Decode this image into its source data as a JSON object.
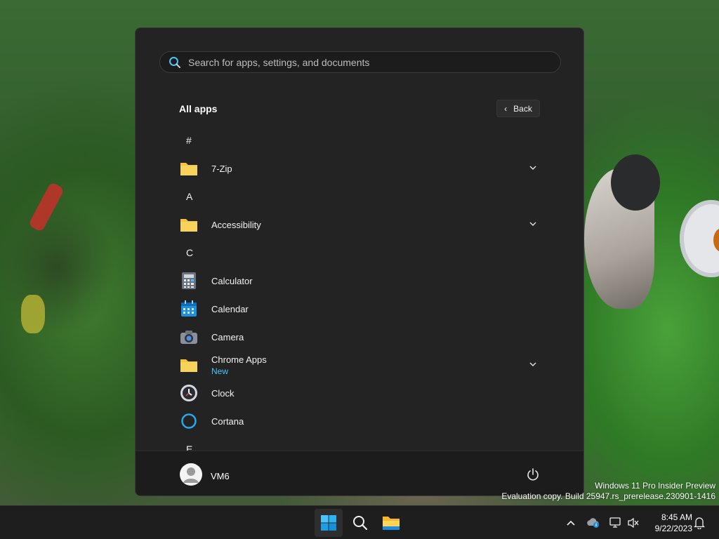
{
  "search": {
    "placeholder": "Search for apps, settings, and documents"
  },
  "all_apps": {
    "title": "All apps",
    "back_label": "Back"
  },
  "sections": {
    "hash": "#",
    "a": "A",
    "c": "C",
    "e": "E"
  },
  "apps": [
    {
      "name": "7-Zip",
      "icon": "folder-icon",
      "expandable": true
    },
    {
      "name": "Accessibility",
      "icon": "folder-icon",
      "expandable": true
    },
    {
      "name": "Calculator",
      "icon": "calculator-icon",
      "expandable": false
    },
    {
      "name": "Calendar",
      "icon": "calendar-icon",
      "expandable": false
    },
    {
      "name": "Camera",
      "icon": "camera-icon",
      "expandable": false
    },
    {
      "name": "Chrome Apps",
      "sub": "New",
      "icon": "folder-icon",
      "expandable": true
    },
    {
      "name": "Clock",
      "icon": "clock-icon",
      "expandable": false
    },
    {
      "name": "Cortana",
      "icon": "cortana-icon",
      "expandable": false
    }
  ],
  "user": {
    "name": "VM6"
  },
  "watermark": {
    "line1": "Windows 11 Pro Insider Preview",
    "line2": "Evaluation copy. Build 25947.rs_prerelease.230901-1416"
  },
  "taskbar": {
    "apps": [
      "start-icon",
      "search-icon",
      "file-explorer-icon"
    ],
    "time": "8:45 AM",
    "date": "9/22/2023"
  },
  "colors": {
    "accent": "#4cc2ff",
    "menu_bg": "#232323",
    "folder": "#f5c33b"
  }
}
